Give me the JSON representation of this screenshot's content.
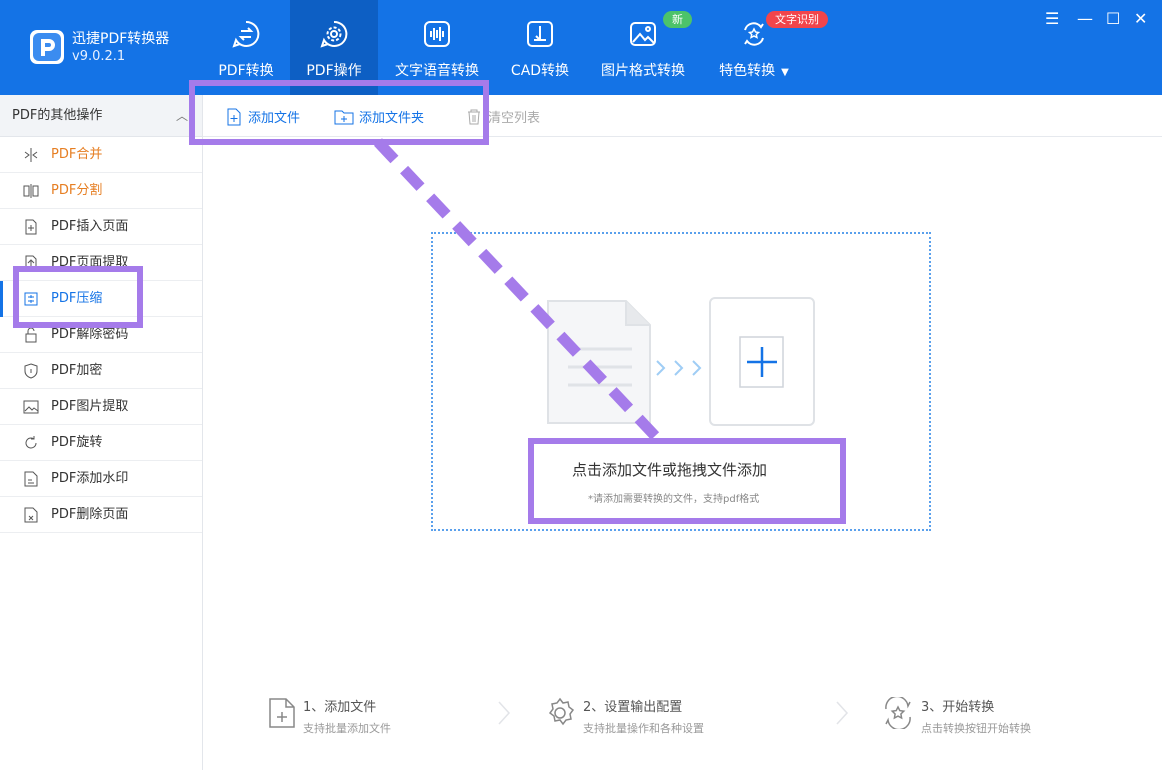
{
  "app": {
    "name": "迅捷PDF转换器",
    "version": "v9.0.2.1"
  },
  "nav": [
    {
      "label": "PDF转换",
      "icon": "convert-icon"
    },
    {
      "label": "PDF操作",
      "icon": "gear-icon",
      "active": true
    },
    {
      "label": "文字语音转换",
      "icon": "waveform-icon"
    },
    {
      "label": "CAD转换",
      "icon": "cad-icon"
    },
    {
      "label": "图片格式转换",
      "icon": "image-icon",
      "badge": "新"
    },
    {
      "label": "特色转换",
      "icon": "star-convert-icon",
      "badge": "文字识别"
    }
  ],
  "sidebar": {
    "title": "PDF的其他操作",
    "items": [
      {
        "label": "PDF合并",
        "icon": "merge-icon"
      },
      {
        "label": "PDF分割",
        "icon": "split-icon"
      },
      {
        "label": "PDF插入页面",
        "icon": "insert-page-icon"
      },
      {
        "label": "PDF页面提取",
        "icon": "extract-page-icon"
      },
      {
        "label": "PDF压缩",
        "icon": "compress-icon",
        "selected": true
      },
      {
        "label": "PDF解除密码",
        "icon": "unlock-icon"
      },
      {
        "label": "PDF加密",
        "icon": "shield-icon"
      },
      {
        "label": "PDF图片提取",
        "icon": "image-extract-icon"
      },
      {
        "label": "PDF旋转",
        "icon": "rotate-icon"
      },
      {
        "label": "PDF添加水印",
        "icon": "watermark-icon"
      },
      {
        "label": "PDF删除页面",
        "icon": "delete-page-icon"
      }
    ]
  },
  "toolbar": {
    "add_file": "添加文件",
    "add_folder": "添加文件夹",
    "clear_list": "清空列表"
  },
  "dropzone": {
    "main": "点击添加文件或拖拽文件添加",
    "sub": "*请添加需要转换的文件，支持pdf格式"
  },
  "steps": [
    {
      "title": "1、添加文件",
      "desc": "支持批量添加文件",
      "icon": "add-file-icon"
    },
    {
      "title": "2、设置输出配置",
      "desc": "支持批量操作和各种设置",
      "icon": "settings-gear-icon"
    },
    {
      "title": "3、开始转换",
      "desc": "点击转换按钮开始转换",
      "icon": "start-convert-icon"
    }
  ],
  "colors": {
    "brand": "#1473e6",
    "highlight": "#a57bea",
    "orange": "#e67e22",
    "badge_new": "#4cc36a",
    "badge_ocr": "#f2454b"
  }
}
